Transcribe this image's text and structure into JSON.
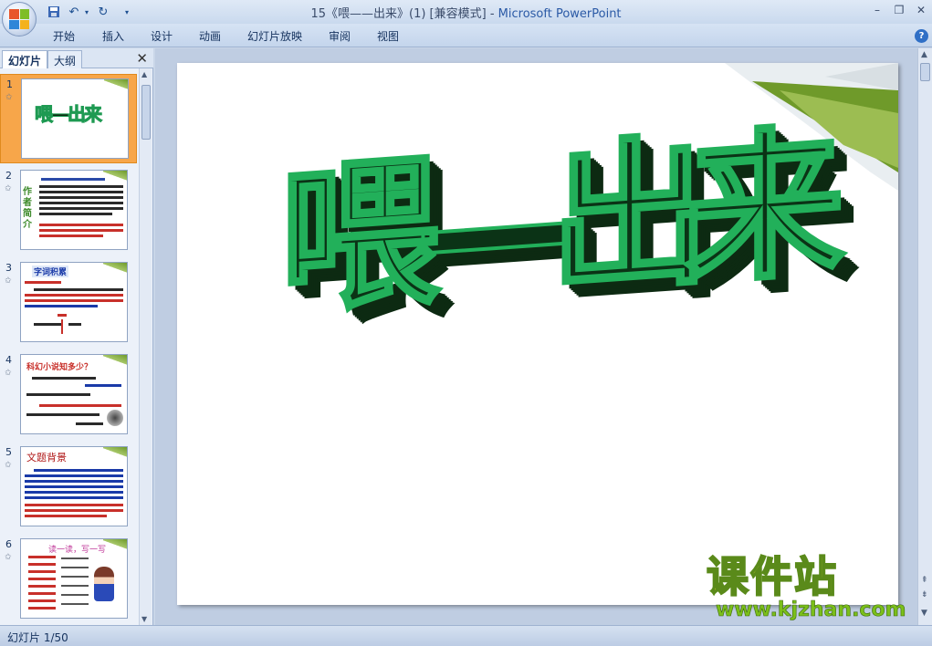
{
  "window": {
    "title_doc": "15《喂——出来》(1) [兼容模式] - ",
    "title_app": "Microsoft PowerPoint",
    "minimize": "–",
    "restore": "❐",
    "close": "✕"
  },
  "quick_access": {
    "save_icon": "save-icon",
    "undo_icon": "undo-icon",
    "redo_icon": "redo-icon"
  },
  "ribbon": {
    "tabs": [
      "开始",
      "插入",
      "设计",
      "动画",
      "幻灯片放映",
      "审阅",
      "视图"
    ],
    "help": "?"
  },
  "panel": {
    "tab_slides": "幻灯片",
    "tab_outline": "大纲",
    "close": "✕",
    "thumbnails": [
      {
        "num": "1",
        "title": "喂—出来"
      },
      {
        "num": "2",
        "title": "作者简介"
      },
      {
        "num": "3",
        "title": "字词积累"
      },
      {
        "num": "4",
        "title": "科幻小说知多少？"
      },
      {
        "num": "5",
        "title": "文题背景"
      },
      {
        "num": "6",
        "title": "读一读，写一写"
      }
    ]
  },
  "slide": {
    "main_title": "喂—出来"
  },
  "status": {
    "text": "幻灯片 1/50"
  },
  "watermark": {
    "logo": "课件站",
    "url": "www.kjzhan.com"
  },
  "colors": {
    "accent": "#2b5aa6",
    "selected_thumb": "#f7a64a",
    "title_green": "#1e9a52",
    "title_dark": "#0d2a12"
  }
}
